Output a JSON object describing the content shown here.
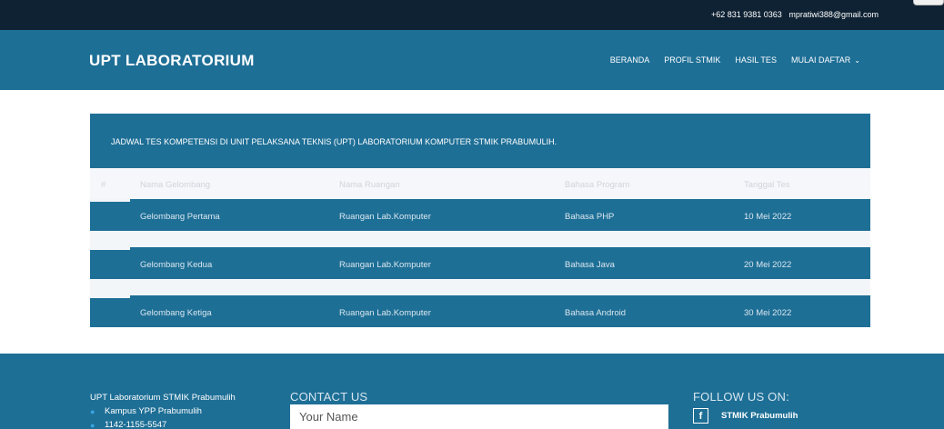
{
  "topbar": {
    "phone": "+62 831 9381 0363",
    "email": "mpratiwi388@gmail.com"
  },
  "brand": "UPT LABORATORIUM",
  "nav": {
    "items": [
      "BERANDA",
      "PROFIL STMIK",
      "HASIL TES",
      "MULAI DAFTAR"
    ]
  },
  "schedule": {
    "title": "JADWAL TES KOMPETENSI DI UNIT PELAKSANA TEKNIS (UPT) LABORATORIUM KOMPUTER STMIK PRABUMULIH.",
    "headers": [
      "#",
      "Nama Gelombang",
      "Nama Ruangan",
      "Bahasa Program",
      "Tanggal Tes"
    ],
    "rows": [
      [
        "",
        "Gelombang Pertama",
        "Ruangan Lab.Komputer",
        "Bahasa PHP",
        "10 Mei 2022"
      ],
      [
        "",
        "Gelombang Kedua",
        "Ruangan Lab.Komputer",
        "Bahasa Java",
        "20 Mei 2022"
      ],
      [
        "",
        "Gelombang Ketiga",
        "Ruangan Lab.Komputer",
        "Bahasa Android",
        "30 Mei 2022"
      ]
    ]
  },
  "footer": {
    "org": "UPT Laboratorium STMIK Prabumulih",
    "address": "Kampus YPP Prabumulih",
    "phone": "1142-1155-5547",
    "contact_heading": "CONTACT US",
    "name_placeholder": "Your Name",
    "follow_heading": "FOLLOW US ON:",
    "facebook_label": "STMIK Prabumulih"
  },
  "colors": {
    "primary": "#1e6f96",
    "topbar": "#0f2233",
    "icon_accent": "#3aa4e0"
  }
}
